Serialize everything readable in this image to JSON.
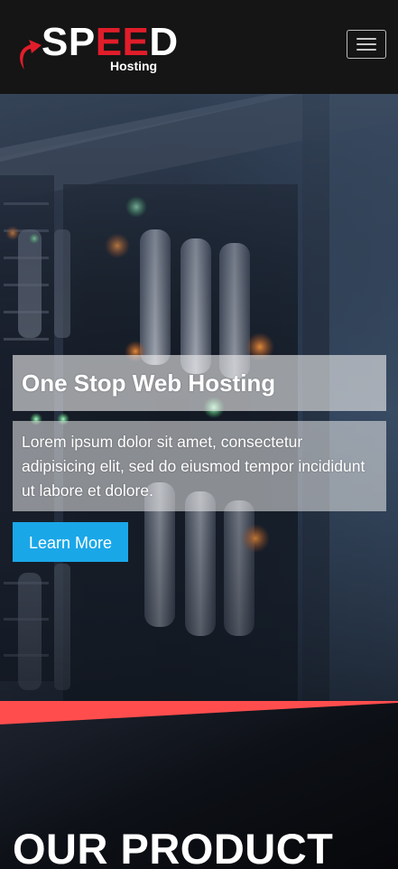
{
  "header": {
    "logo": {
      "prefix": "SP",
      "highlight": "EE",
      "suffix": "D",
      "subtitle": "Hosting",
      "accent_color": "#e11d2a"
    },
    "menu_icon": "hamburger-menu-icon"
  },
  "hero": {
    "headline": "One Stop Web Hosting",
    "description": "Lorem ipsum dolor sit amet, consectetur adipisicing elit, sed do eiusmod tempor incididunt ut labore et dolore.",
    "cta_label": "Learn More",
    "cta_color": "#1aa7e8"
  },
  "product": {
    "title": "OUR PRODUCT"
  }
}
